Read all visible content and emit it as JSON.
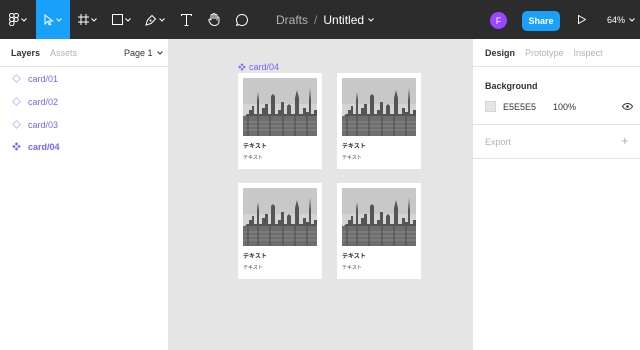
{
  "toolbar": {
    "breadcrumb_parent": "Drafts",
    "breadcrumb_separator": "/",
    "file_name": "Untitled",
    "avatar_initial": "F",
    "share_label": "Share",
    "zoom_level": "64%"
  },
  "left_panel": {
    "tabs": [
      "Layers",
      "Assets"
    ],
    "page_label": "Page 1",
    "layers": [
      {
        "name": "card/01",
        "selected": false
      },
      {
        "name": "card/02",
        "selected": false
      },
      {
        "name": "card/03",
        "selected": false
      },
      {
        "name": "card/04",
        "selected": true
      }
    ]
  },
  "right_panel": {
    "tabs": [
      "Design",
      "Prototype",
      "Inspect"
    ],
    "background_title": "Background",
    "background_hex": "E5E5E5",
    "background_opacity": "100%",
    "export_title": "Export"
  },
  "canvas": {
    "frame_label": "card/04",
    "cards": [
      {
        "title": "テキスト",
        "subtitle": "テキスト"
      },
      {
        "title": "テキスト",
        "subtitle": "テキスト"
      },
      {
        "title": "テキスト",
        "subtitle": "テキスト"
      },
      {
        "title": "テキスト",
        "subtitle": "テキスト"
      }
    ]
  },
  "colors": {
    "toolbar_bg": "#2c2c2c",
    "accent": "#18a0fb",
    "component": "#7b61ff",
    "canvas_bg": "#e5e5e5"
  }
}
